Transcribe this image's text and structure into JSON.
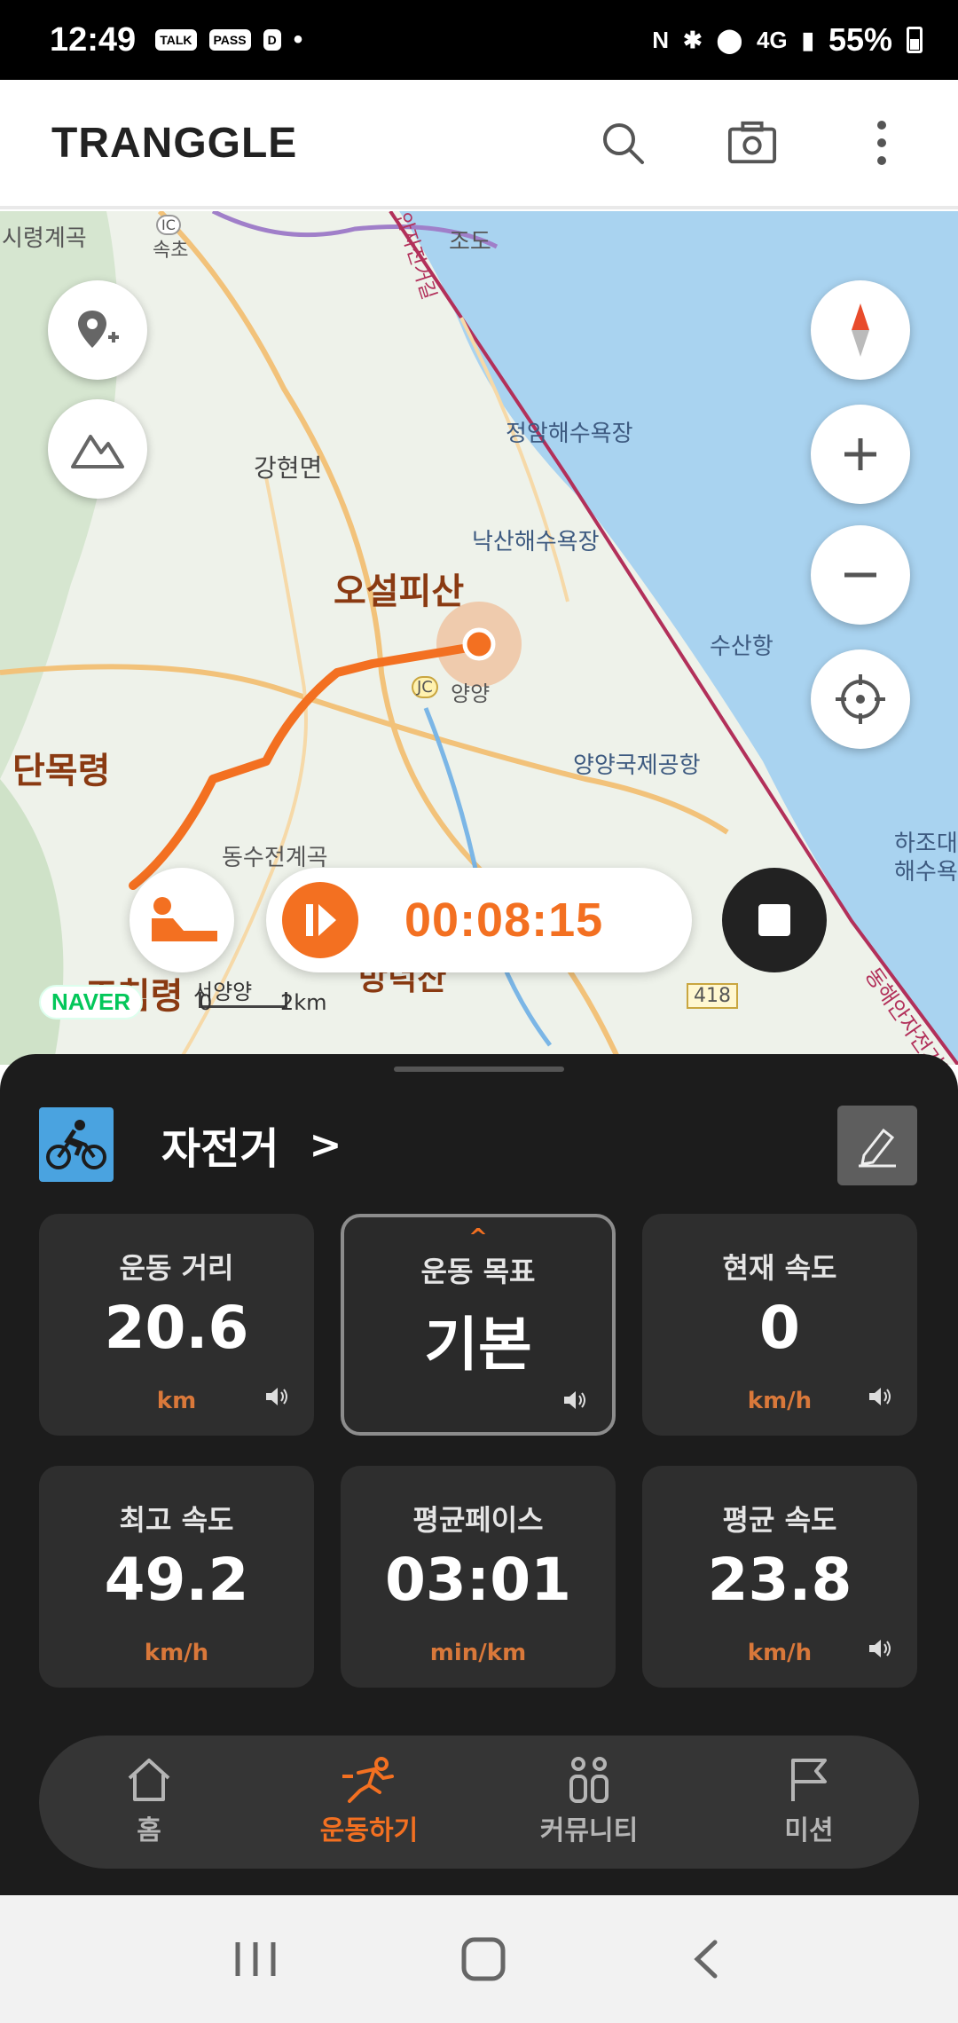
{
  "status_bar": {
    "time": "12:49",
    "battery": "55%",
    "left_icons": [
      "TALK",
      "PASS",
      "D"
    ],
    "network": "4G"
  },
  "app_bar": {
    "logo": "TRANGGLE",
    "icons": [
      "search-icon",
      "camera-icon",
      "more-icon"
    ]
  },
  "map": {
    "labels": {
      "l1": "시령계곡",
      "l2": "속초",
      "l3": "조도",
      "l4": "정암해수욕장",
      "l5": "강현면",
      "l6": "낙산해수욕장",
      "l7": "오설피산",
      "l8": "수산항",
      "l9": "양양",
      "l10": "양양국제공항",
      "l11": "단목령",
      "l12": "하조대",
      "l13": "해수욕",
      "l14": "동수전계곡",
      "l15": "조침령",
      "l16": "서양양",
      "l17": "방덕산",
      "l18": "418",
      "l19": "동해안자전거길",
      "l20": "안자전거길",
      "jc": "JC",
      "ic": "IC"
    },
    "naver": "NAVER",
    "scale_start": "0",
    "scale_end": "2km"
  },
  "tracker": {
    "timer": "00:08:15"
  },
  "activity": {
    "title": "자전거",
    "chevron": ">"
  },
  "stats": [
    {
      "label": "운동 거리",
      "value": "20.6",
      "unit": "km"
    },
    {
      "label": "운동 목표",
      "value": "기본",
      "unit": ""
    },
    {
      "label": "현재 속도",
      "value": "0",
      "unit": "km/h"
    },
    {
      "label": "최고 속도",
      "value": "49.2",
      "unit": "km/h"
    },
    {
      "label": "평균페이스",
      "value": "03:01",
      "unit": "min/km"
    },
    {
      "label": "평균 속도",
      "value": "23.8",
      "unit": "km/h"
    }
  ],
  "nav": [
    {
      "label": "홈"
    },
    {
      "label": "운동하기"
    },
    {
      "label": "커뮤니티"
    },
    {
      "label": "미션"
    }
  ],
  "colors": {
    "accent": "#f37021",
    "sheet": "#1c1c1c",
    "card": "#2e2e2e",
    "sea": "#a9d3f0"
  }
}
